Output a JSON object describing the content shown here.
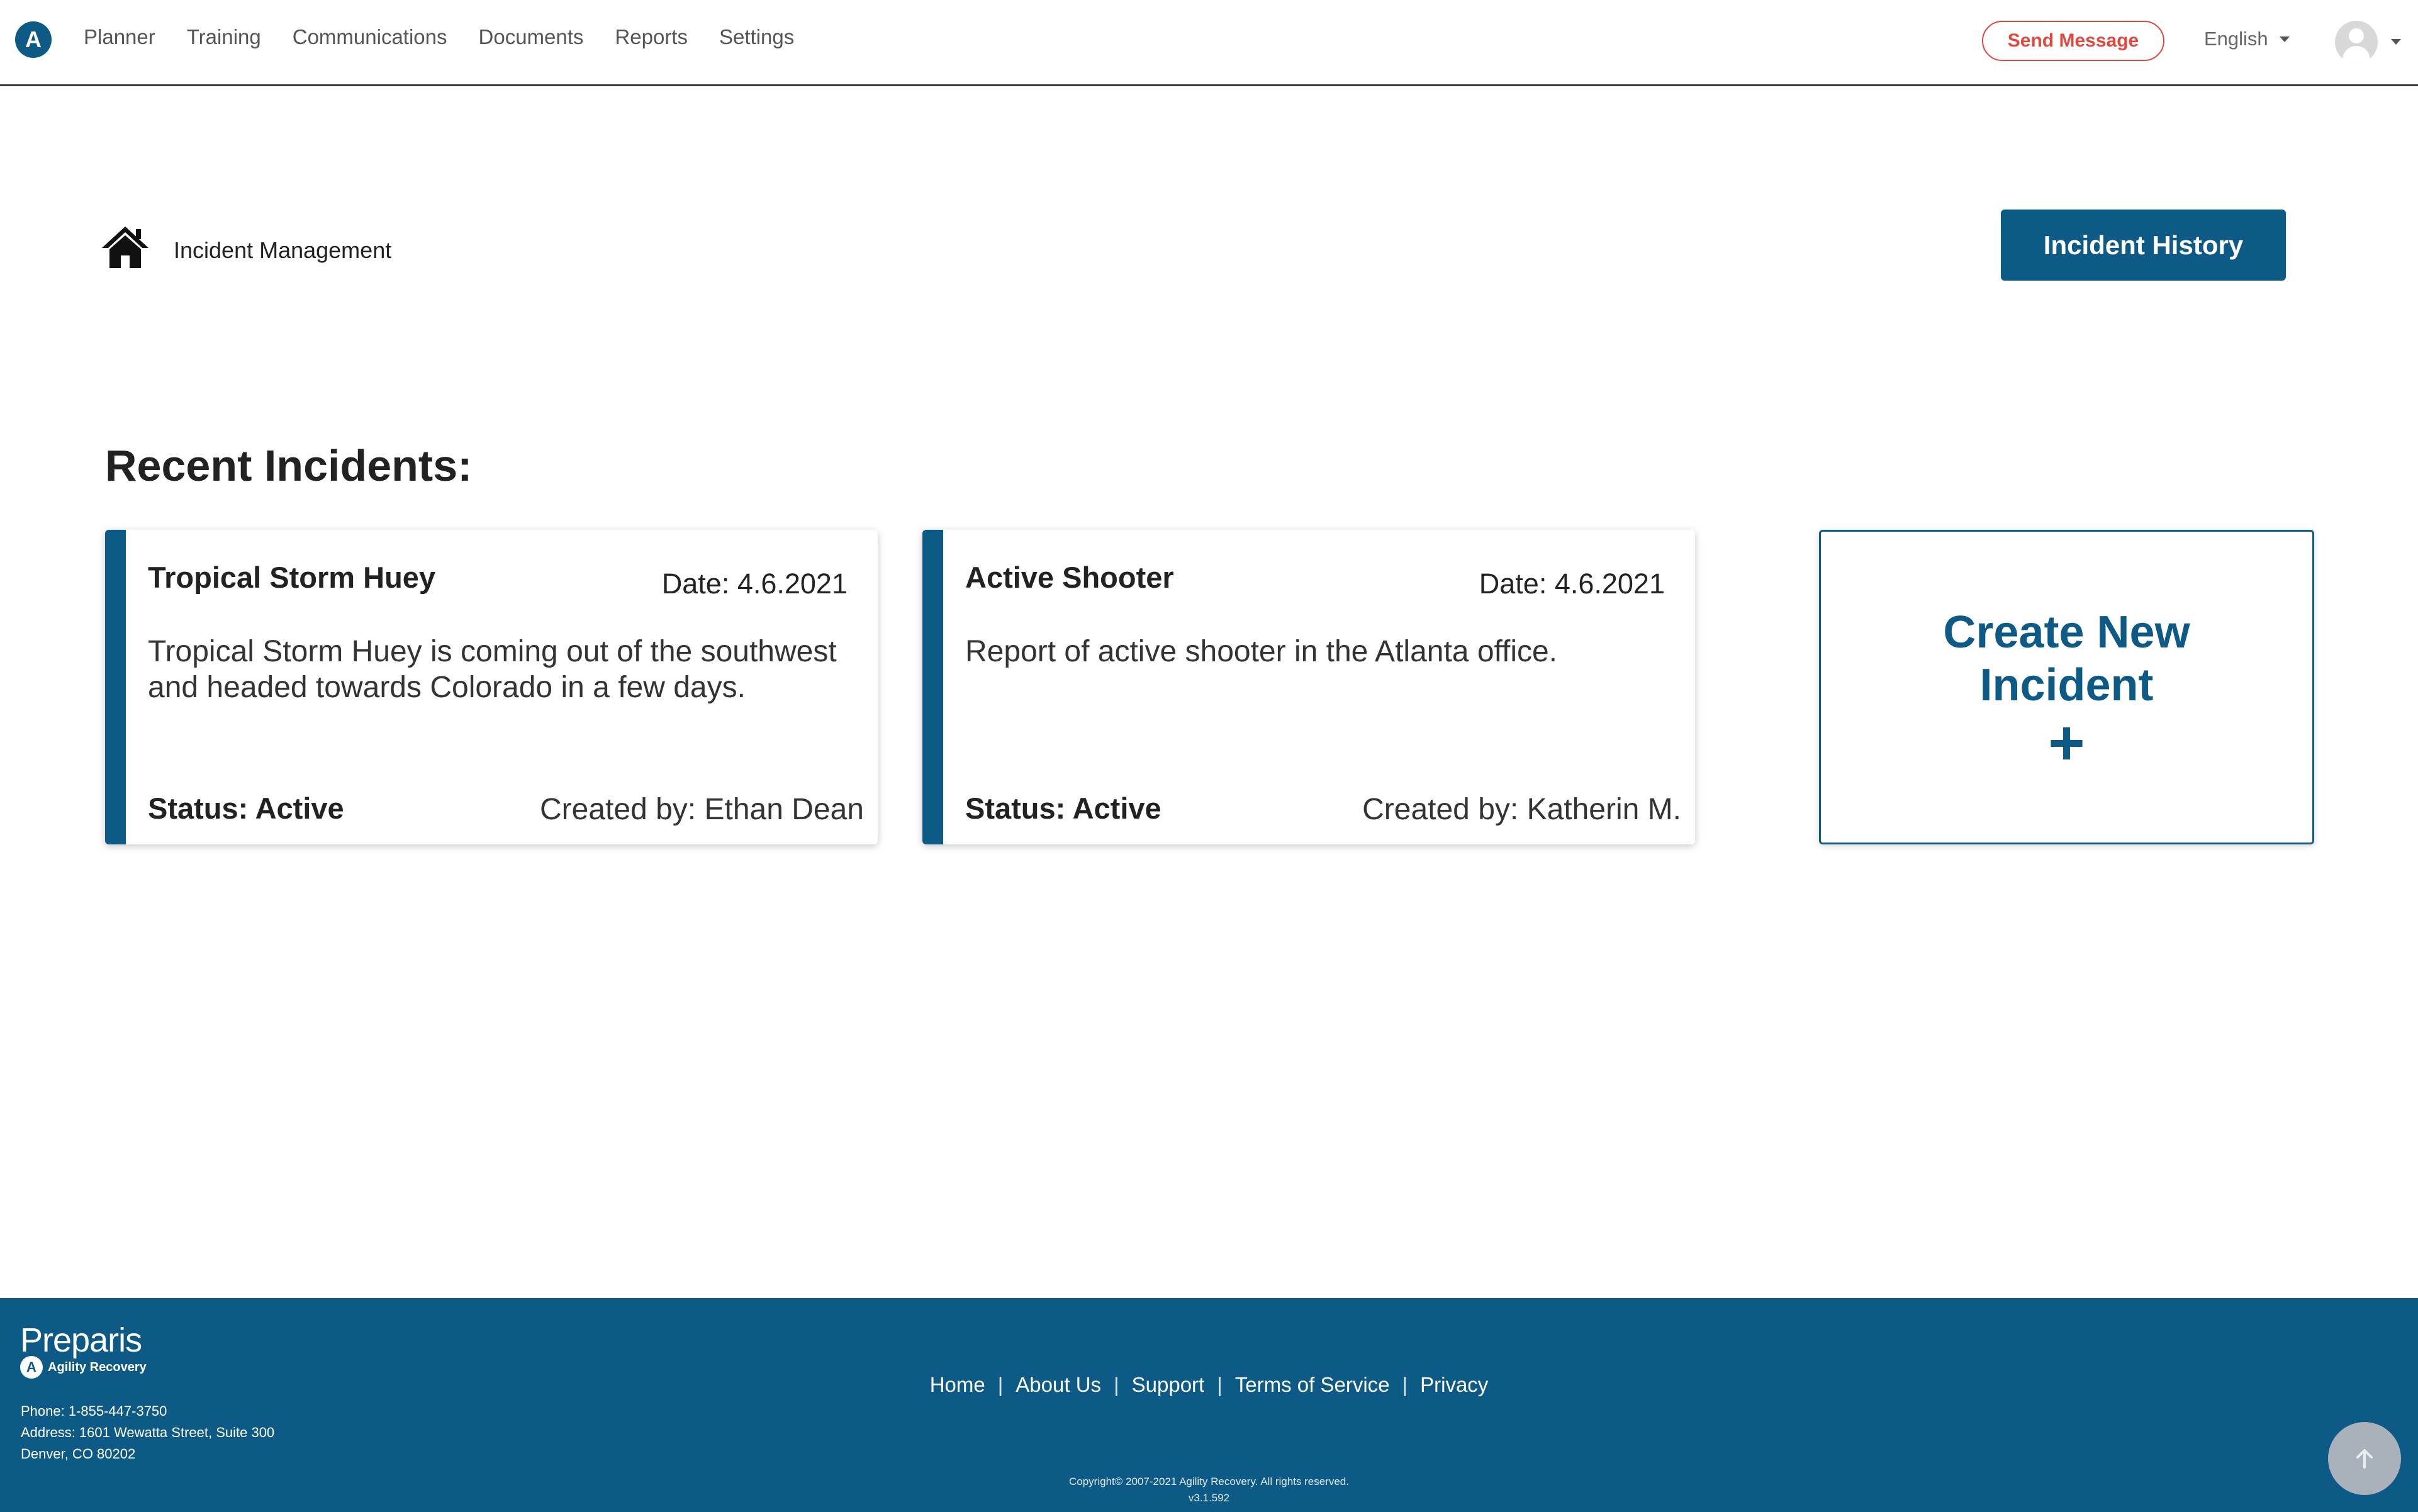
{
  "nav": {
    "logo_letter": "A",
    "items": [
      {
        "label": "Planner"
      },
      {
        "label": "Training"
      },
      {
        "label": "Communications"
      },
      {
        "label": "Documents"
      },
      {
        "label": "Reports"
      },
      {
        "label": "Settings"
      }
    ],
    "send_message_label": "Send Message",
    "language": "English"
  },
  "breadcrumb": {
    "icon": "home-icon",
    "label": "Incident Management"
  },
  "incident_history_label": "Incident History",
  "recent": {
    "title": "Recent Incidents:",
    "cards": [
      {
        "title": "Tropical Storm Huey",
        "date": "Date: 4.6.2021",
        "description": "Tropical Storm Huey is coming out of the southwest and headed towards Colorado in a few days.",
        "status": "Status: Active",
        "created_by": "Created by: Ethan Dean"
      },
      {
        "title": "Active Shooter",
        "date": "Date: 4.6.2021",
        "description": "Report of active shooter in the Atlanta office.",
        "status": "Status: Active",
        "created_by": "Created by: Katherin M."
      }
    ],
    "create_label": "Create New Incident",
    "create_icon": "+"
  },
  "footer": {
    "brand": "Preparis",
    "brand_sub": "Agility Recovery",
    "phone": "Phone: 1-855-447-3750",
    "address": "Address: 1601 Wewatta Street, Suite 300",
    "city": "Denver, CO 80202",
    "links": [
      "Home",
      "About Us",
      "Support",
      "Terms of Service",
      "Privacy"
    ],
    "copyright": "Copyright© 2007-2021 Agility Recovery. All rights reserved.",
    "version": "v3.1.592"
  },
  "colors": {
    "brand": "#0e5a86",
    "alert": "#e0483d"
  }
}
